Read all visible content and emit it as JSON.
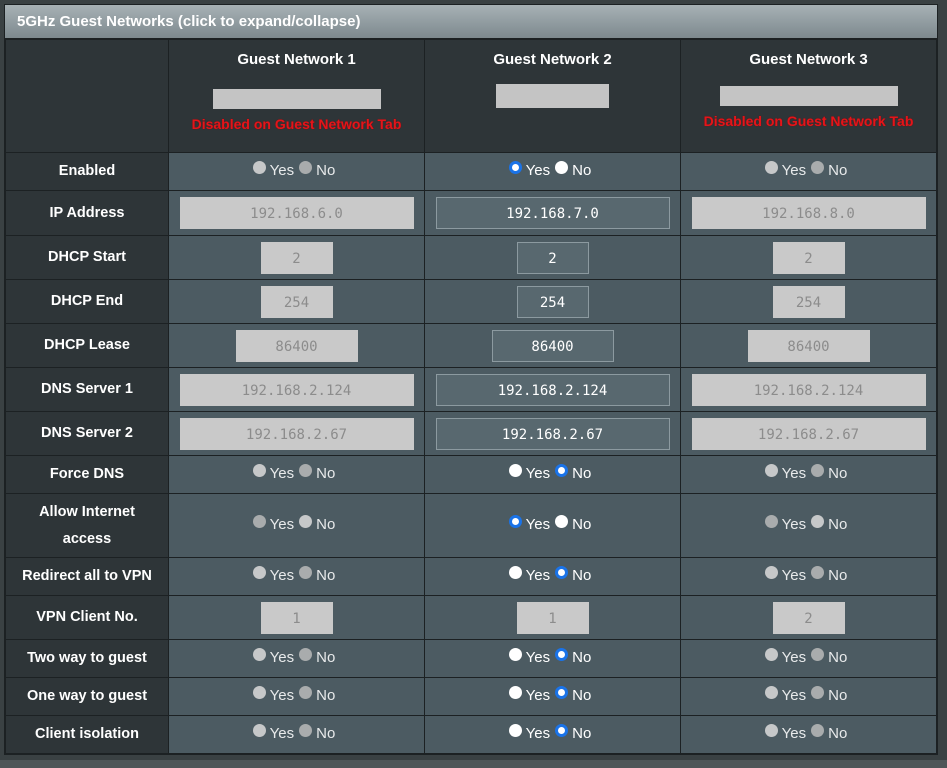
{
  "panel": {
    "title": "5GHz Guest Networks (click to expand/collapse)"
  },
  "networks": [
    {
      "name": "Guest Network 1",
      "note": "Disabled on Guest Network Tab",
      "disabled": true
    },
    {
      "name": "Guest Network 2",
      "note": "",
      "disabled": false
    },
    {
      "name": "Guest Network 3",
      "note": "Disabled on Guest Network Tab",
      "disabled": true
    }
  ],
  "radio_labels": {
    "yes": "Yes",
    "no": "No"
  },
  "rows": [
    {
      "label": "Enabled",
      "type": "radio",
      "values": [
        "No",
        "Yes",
        "No"
      ]
    },
    {
      "label": "IP Address",
      "type": "text",
      "size": "wide",
      "values": [
        "192.168.6.0",
        "192.168.7.0",
        "192.168.8.0"
      ]
    },
    {
      "label": "DHCP Start",
      "type": "text",
      "size": "sm",
      "values": [
        "2",
        "2",
        "2"
      ]
    },
    {
      "label": "DHCP End",
      "type": "text",
      "size": "sm",
      "values": [
        "254",
        "254",
        "254"
      ]
    },
    {
      "label": "DHCP Lease",
      "type": "text",
      "size": "md",
      "values": [
        "86400",
        "86400",
        "86400"
      ]
    },
    {
      "label": "DNS Server 1",
      "type": "text",
      "size": "wide",
      "values": [
        "192.168.2.124",
        "192.168.2.124",
        "192.168.2.124"
      ]
    },
    {
      "label": "DNS Server 2",
      "type": "text",
      "size": "wide",
      "values": [
        "192.168.2.67",
        "192.168.2.67",
        "192.168.2.67"
      ]
    },
    {
      "label": "Force DNS",
      "type": "radio",
      "values": [
        "No",
        "No",
        "No"
      ]
    },
    {
      "label": "Allow Internet access",
      "type": "radio",
      "values": [
        "Yes",
        "Yes",
        "Yes"
      ],
      "tall": true
    },
    {
      "label": "Redirect all to VPN",
      "type": "radio",
      "values": [
        "No",
        "No",
        "No"
      ]
    },
    {
      "label": "VPN Client No.",
      "type": "text",
      "size": "sm",
      "values": [
        "1",
        "1",
        "2"
      ],
      "all_disabled": true
    },
    {
      "label": "Two way to guest",
      "type": "radio",
      "values": [
        "No",
        "No",
        "No"
      ]
    },
    {
      "label": "One way to guest",
      "type": "radio",
      "values": [
        "No",
        "No",
        "No"
      ]
    },
    {
      "label": "Client isolation",
      "type": "radio",
      "values": [
        "No",
        "No",
        "No"
      ]
    }
  ],
  "colors": {
    "accent_radio": "#1a73e8",
    "disabled_note": "#e3151a",
    "cell_bg": "#4c5b62",
    "label_bg": "#2e3538"
  }
}
